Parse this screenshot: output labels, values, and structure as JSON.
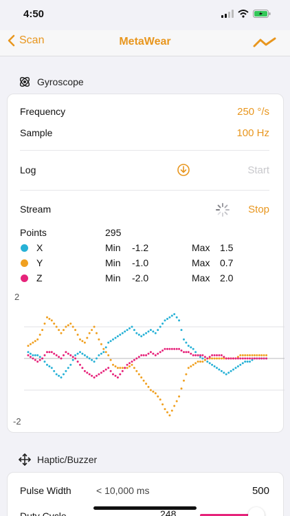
{
  "status": {
    "time": "4:50"
  },
  "nav": {
    "back_label": "Scan",
    "title": "MetaWear"
  },
  "gyro": {
    "header": "Gyroscope",
    "frequency_label": "Frequency",
    "frequency_value": "250 °/s",
    "sample_label": "Sample",
    "sample_value": "100 Hz",
    "log_label": "Log",
    "log_action": "Start",
    "stream_label": "Stream",
    "stream_action": "Stop",
    "points_label": "Points",
    "points_value": "295",
    "min_label": "Min",
    "max_label": "Max",
    "axes": [
      {
        "name": "X",
        "color": "#27b1d6",
        "min": "-1.2",
        "max": "1.5"
      },
      {
        "name": "Y",
        "color": "#f0a020",
        "min": "-1.0",
        "max": "0.7"
      },
      {
        "name": "Z",
        "color": "#e6237a",
        "min": "-2.0",
        "max": "2.0"
      }
    ]
  },
  "chart_data": {
    "type": "scatter",
    "ylim": [
      -2,
      2
    ],
    "ytick_top": "2",
    "ytick_bottom": "-2",
    "series": [
      {
        "name": "X",
        "color": "#27b1d6",
        "values": [
          0.2,
          0.1,
          0.1,
          0.0,
          -0.2,
          -0.3,
          -0.5,
          -0.6,
          -0.4,
          -0.2,
          0.1,
          0.2,
          0.1,
          0.0,
          -0.1,
          0.1,
          0.2,
          0.5,
          0.6,
          0.7,
          0.8,
          0.9,
          1.0,
          0.8,
          0.7,
          0.8,
          0.9,
          0.8,
          1.0,
          1.2,
          1.3,
          1.4,
          1.2,
          0.6,
          0.4,
          0.3,
          0.1,
          0.0,
          -0.1,
          -0.2,
          -0.3,
          -0.4,
          -0.5,
          -0.4,
          -0.3,
          -0.2,
          -0.1,
          -0.1,
          0.0,
          0.0,
          0.0,
          0.0
        ]
      },
      {
        "name": "Y",
        "color": "#f0a020",
        "values": [
          0.4,
          0.5,
          0.6,
          0.9,
          1.3,
          1.2,
          1.0,
          0.8,
          1.0,
          1.1,
          0.9,
          0.6,
          0.5,
          0.8,
          1.0,
          0.6,
          0.3,
          0.1,
          -0.2,
          -0.3,
          -0.3,
          -0.3,
          -0.2,
          -0.4,
          -0.6,
          -0.8,
          -1.0,
          -1.1,
          -1.3,
          -1.6,
          -1.8,
          -1.5,
          -1.2,
          -0.7,
          -0.3,
          -0.2,
          -0.1,
          -0.1,
          0.0,
          0.0,
          0.0,
          0.0,
          0.0,
          0.0,
          0.0,
          0.1,
          0.1,
          0.1,
          0.1,
          0.1,
          0.1,
          0.1
        ]
      },
      {
        "name": "Z",
        "color": "#e6237a",
        "values": [
          0.1,
          0.0,
          -0.1,
          0.0,
          0.2,
          0.2,
          0.1,
          0.0,
          0.2,
          0.1,
          0.0,
          -0.2,
          -0.4,
          -0.5,
          -0.6,
          -0.5,
          -0.4,
          -0.3,
          -0.5,
          -0.6,
          -0.4,
          -0.2,
          -0.1,
          0.0,
          0.1,
          0.1,
          0.2,
          0.1,
          0.2,
          0.3,
          0.3,
          0.3,
          0.3,
          0.2,
          0.2,
          0.1,
          0.1,
          0.1,
          0.0,
          0.1,
          0.1,
          0.1,
          0.0,
          0.0,
          0.0,
          0.0,
          0.0,
          0.0,
          0.0,
          0.0,
          0.0,
          0.0
        ]
      }
    ]
  },
  "haptic": {
    "header": "Haptic/Buzzer",
    "pulse_label": "Pulse Width",
    "pulse_hint": "< 10,000 ms",
    "pulse_value": "500",
    "duty_label": "Duty Cycle",
    "duty_value": "248"
  }
}
